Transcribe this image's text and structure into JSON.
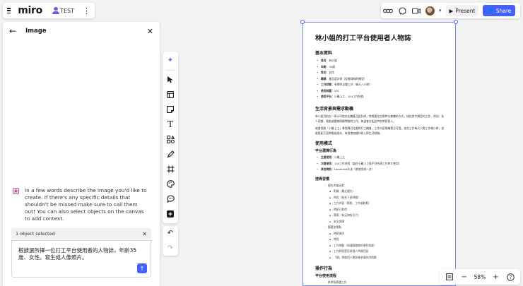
{
  "header": {
    "logo": "miro",
    "board_name": "TEST"
  },
  "topright": {
    "present_label": "Present",
    "share_label": "Share"
  },
  "panel": {
    "title": "Image",
    "hint": "In a few words describe the image you'd like to create. If there's any specific details that shouldn't be missed make sure to call them out! You can also select objects on the canvas to add context.",
    "selection_text": "1 object selected",
    "prompt_value": "根據選所擇一位打工平台使用者的人物誌，年齡35歲、女性。寫生成人像照片。"
  },
  "zoom": {
    "level": "58%"
  },
  "icons": {
    "menu": "hamburger-icon",
    "user": "user-icon",
    "more": "kebab-icon",
    "apps": "apps-icon",
    "chat": "chat-icon",
    "video": "video-icon",
    "present": "play-icon",
    "share": "user-add-icon",
    "back": "arrow-left-icon",
    "close": "close-icon",
    "send": "arrow-up-icon",
    "fit": "fit-screen-icon",
    "help": "help-icon"
  },
  "colors": {
    "accent": "#4262ff",
    "ai": "#7b55d8",
    "hint_icon": "#c04c9a"
  },
  "doc": {
    "title": "林小姐的打工平台使用者人物誌",
    "sec1": "基本資料",
    "basic": [
      {
        "k": "姓名",
        "v": "：林小姐"
      },
      {
        "k": "年齡",
        "v": "：35歲"
      },
      {
        "k": "性別",
        "v": "：女性"
      },
      {
        "k": "職業",
        "v": "：產品設計師（從教育線的轉型）"
      },
      {
        "k": "工作狀態",
        "v": "：有彈性全職工作（每天八小時）"
      },
      {
        "k": "使用裝置",
        "v": "：iOS"
      },
      {
        "k": "使用平台",
        "v": "：小雞上工、104工作快找"
      }
    ],
    "sec2": "生活背景與需求動機",
    "para1": "林小姐目前在一家公司擔任全職產品設計師，常需要在空暇時以兼職的方式，接些其它類型的工作，例如：私人家教、餐飲或寵物照顧等臨時工作，每週會分配出特定時段投入。",
    "para2": "她會透過「小雞上工」尋找鄰近住處的打工機會，工作內容需確實且可靠，這些工作每天只需工作幾小時，並能搭配下班時間或週末，有效增加額外收入與生活經驗。",
    "sec3": "使用模式",
    "sub1": "平台選擇行為",
    "plat": [
      {
        "k": "主要使用",
        "v": "：小雞上工"
      },
      {
        "k": "次要使用",
        "v": "：104工作快找（當在小雞上工找不到合適工作時才使用）"
      },
      {
        "k": "其他資訊",
        "v": "：Lalamove外送（曾使用過一次）"
      }
    ],
    "sub2": "搜尋習慣",
    "s_a": "優先考量因素：",
    "s_a_items": [
      "距離（最近優先）",
      "時段（配合下班時間）",
      "工作內容（輕鬆、工作量較輕）",
      "時薪已取得",
      "薪資（有足夠吸引力）",
      "安全保障"
    ],
    "s_b": "篩選決策點：",
    "s_b_items": [
      "時薪資訊",
      "時段",
      "工作地點（與通勤路線的便利程度）",
      "工作時段是否與個人時間匹配",
      "「讚」等使用人數與尋求過的評價數"
    ],
    "sec4": "操作行為",
    "sub3": "平台使用流程",
    "flow": [
      "依時段篩選工作"
    ]
  }
}
